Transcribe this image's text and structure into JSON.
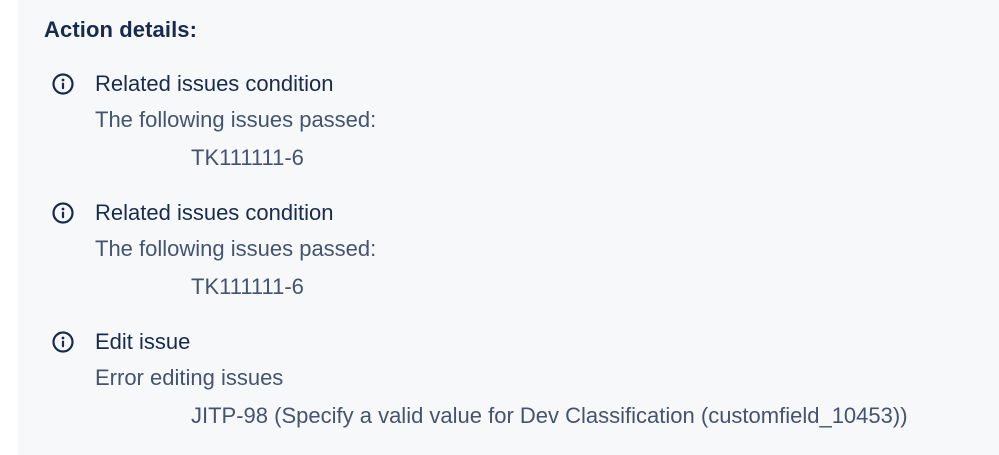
{
  "heading": "Action details:",
  "items": [
    {
      "icon": "info-icon",
      "title": "Related issues condition",
      "description": "The following issues passed:",
      "detail": "TK111111-6"
    },
    {
      "icon": "info-icon",
      "title": "Related issues condition",
      "description": "The following issues passed:",
      "detail": "TK111111-6"
    },
    {
      "icon": "info-icon",
      "title": "Edit issue",
      "description": "Error editing issues",
      "detail": "JITP-98 (Specify a valid value for Dev Classification (customfield_10453))"
    }
  ]
}
